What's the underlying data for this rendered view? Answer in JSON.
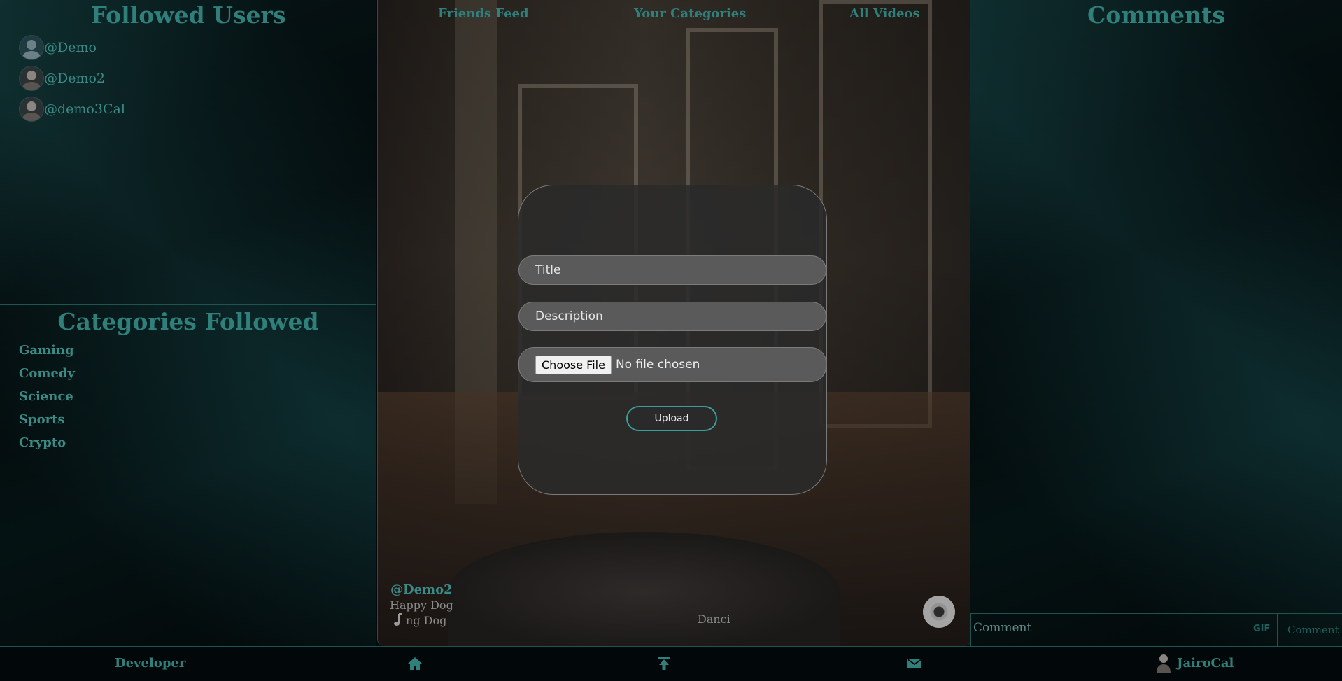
{
  "followed_users": {
    "title": "Followed Users",
    "users": [
      {
        "handle": "@Demo"
      },
      {
        "handle": "@Demo2"
      },
      {
        "handle": "@demo3Cal"
      }
    ]
  },
  "categories_followed": {
    "title": "Categories Followed",
    "items": [
      "Gaming",
      "Comedy",
      "Science",
      "Sports",
      "Crypto"
    ]
  },
  "feed_tabs": [
    "Friends Feed",
    "Your Categories",
    "All Videos"
  ],
  "upload_modal": {
    "title_placeholder": "Title",
    "description_placeholder": "Description",
    "choose_file_label": "Choose File",
    "no_file_text": "No file chosen",
    "upload_label": "Upload"
  },
  "video": {
    "user": "@Demo2",
    "description": "Happy Dog",
    "song_partial": "ng Dog",
    "song_scroll": "Danci"
  },
  "comments": {
    "title": "Comments",
    "input_placeholder": "Comment",
    "gif_label": "GIF",
    "send_label": "Comment"
  },
  "bottom_bar": {
    "developer_label": "Developer",
    "username": "JairoCal"
  },
  "colors": {
    "accent": "#2f7f7b",
    "background": "#03090b",
    "modal_bg": "#2a2a2a",
    "upload_border": "#3a9f9a"
  }
}
